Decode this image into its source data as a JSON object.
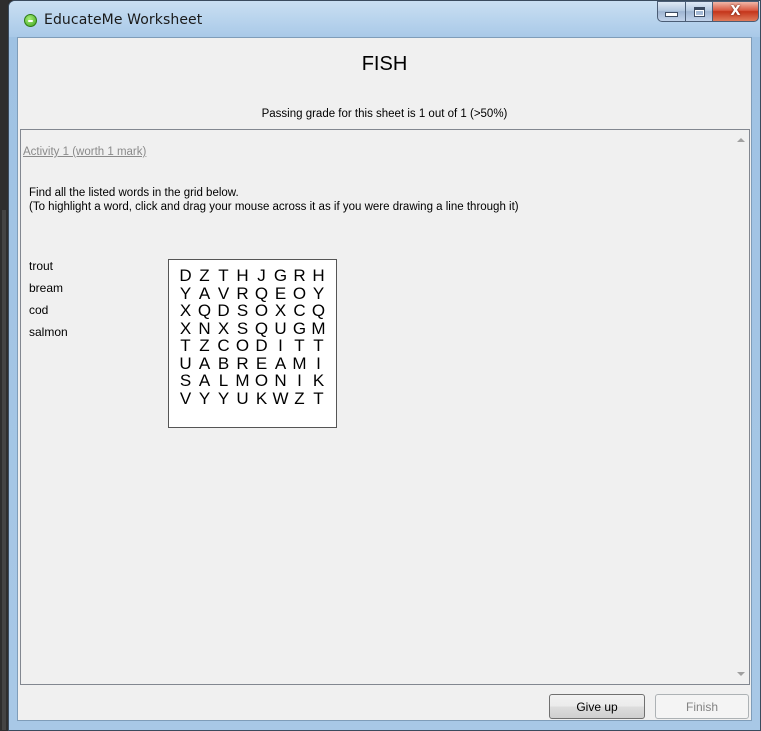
{
  "window": {
    "title": "EducateMe Worksheet",
    "close_symbol": "X"
  },
  "sheet": {
    "title": "FISH",
    "passing_text": "Passing grade for this sheet is 1 out of 1 (>50%)"
  },
  "activity": {
    "link_label": "Activity 1 (worth 1 mark)",
    "instruction_1": "Find all the listed words in the grid below.",
    "instruction_2": "(To highlight a word, click and drag your mouse across it as if you were drawing a line through it)",
    "words": [
      "trout",
      "bream",
      "cod",
      "salmon"
    ],
    "grid": [
      [
        "D",
        "Z",
        "T",
        "H",
        "J",
        "G",
        "R",
        "H"
      ],
      [
        "Y",
        "A",
        "V",
        "R",
        "Q",
        "E",
        "O",
        "Y"
      ],
      [
        "X",
        "Q",
        "D",
        "S",
        "O",
        "X",
        "C",
        "Q"
      ],
      [
        "X",
        "N",
        "X",
        "S",
        "Q",
        "U",
        "G",
        "M"
      ],
      [
        "T",
        "Z",
        "C",
        "O",
        "D",
        "I",
        "T",
        "T"
      ],
      [
        "U",
        "A",
        "B",
        "R",
        "E",
        "A",
        "M",
        "I"
      ],
      [
        "S",
        "A",
        "L",
        "M",
        "O",
        "N",
        "I",
        "K"
      ],
      [
        "V",
        "Y",
        "Y",
        "U",
        "K",
        "W",
        "Z",
        "T"
      ]
    ]
  },
  "buttons": {
    "give_up": "Give up",
    "finish": "Finish"
  },
  "icons": {
    "app": "educateme-app-icon",
    "minimize": "minimize-icon",
    "maximize": "maximize-icon",
    "close": "close-icon"
  }
}
